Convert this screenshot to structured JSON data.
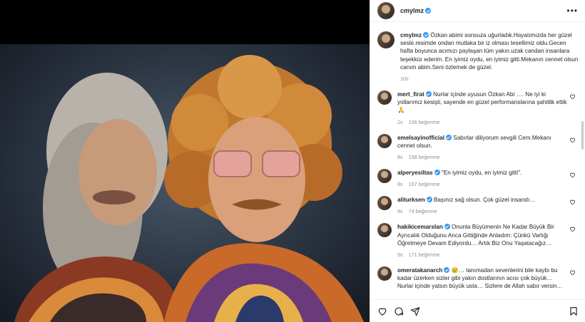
{
  "post": {
    "username": "cmylmz",
    "caption": "Özkan abimi sonsuza uğurladık.Hayatımızda her güzel sesle.resimde ondan mutlaka bir iz olması tesellimiz oldu.Gecen hafta boyunca acımızı paylaşan tüm yakın.uzak candan insanlara teşekkür ederim. En iyimiz oydu, en iyimiz gitti.Mekanın cennet olsun canım abim.Seni özlemek de güzel.",
    "time": "10s"
  },
  "comments": [
    {
      "username": "mert_firat",
      "text": "Nurlar içinde uyusun Özkan Abi …. Ne iyi ki yollarımız kesişti, sayende en güzel performanslarına şahitlik ettik 🙏",
      "time": "2s",
      "likes": "106 beğenme"
    },
    {
      "username": "emelsayinofficial",
      "text": "Sabırlar diliyorum sevgili Cem.Mekanı cennet olsun.",
      "time": "8s",
      "likes": "158 beğenme"
    },
    {
      "username": "alperyesiltas",
      "text": "\"En iyimiz oydu, en iyimiz gitti\".",
      "time": "8s",
      "likes": "107 beğenme"
    },
    {
      "username": "aliturksen",
      "text": "Başınız sağ olsun. Çok güzel insandı…",
      "time": "9s",
      "likes": "74 beğenme"
    },
    {
      "username": "hakikicemarslan",
      "text": "Onunla Büyümenin Ne Kadar Büyük Bir Ayrıcalık Olduğunu Anca Gittiğinde Anladım: Çünkü Varlığı Öğretmeye Devam Ediyordu… Artık Biz Onu Yaşatacağız…",
      "time": "9s",
      "likes": "171 beğenme"
    },
    {
      "username": "omeratakanarch",
      "text": "😢… tanımadan sevenlerini bile kaybı bu kadar üzerken sizler gibi yakın dostlarının acısı çok büyük… Nurlar içinde yatsın büyük usta… Sizlere de Allah sabır versin…",
      "time": "",
      "likes": ""
    }
  ],
  "icons": {
    "more": "more-options-icon",
    "like": "heart-icon",
    "comment": "comment-icon",
    "share": "share-icon",
    "save": "bookmark-icon"
  }
}
